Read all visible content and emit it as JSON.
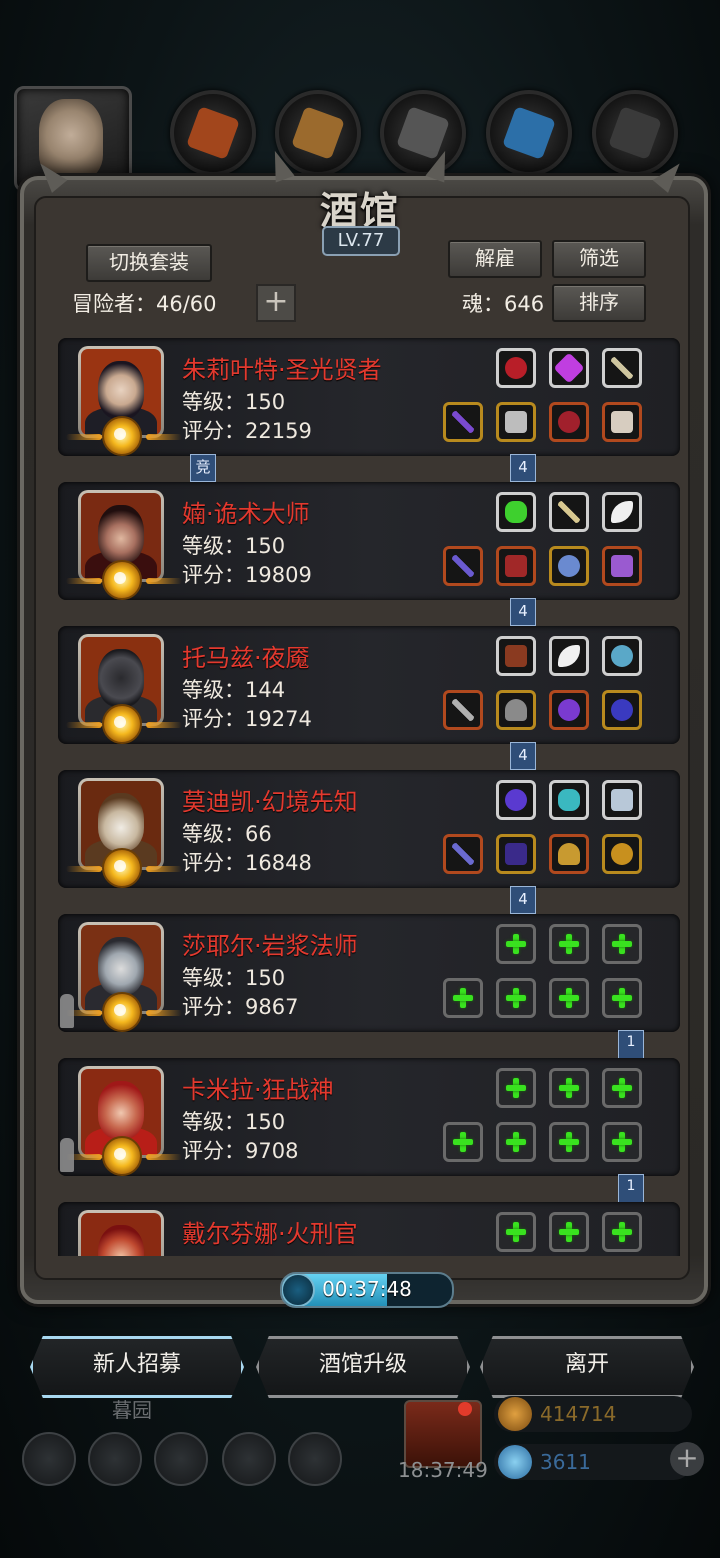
{
  "tavern": {
    "title": "酒馆",
    "level": "LV.77",
    "switch_set_label": "切换套装",
    "dismiss_label": "解雇",
    "filter_label": "筛选",
    "sort_label": "排序",
    "adventurers_label": "冒险者：46/60",
    "soul_label": "魂：646",
    "add_label": "+"
  },
  "heroes": [
    {
      "name": "朱莉叶特·圣光贤者",
      "level": "等级：150",
      "score": "评分：22159",
      "link_left": "竞",
      "link_right": "4"
    },
    {
      "name": "婻·诡术大师",
      "level": "等级：150",
      "score": "评分：19809",
      "link_right": "4"
    },
    {
      "name": "托马兹·夜魇",
      "level": "等级：144",
      "score": "评分：19274",
      "link_right": "4"
    },
    {
      "name": "莫迪凯·幻境先知",
      "level": "等级：66",
      "score": "评分：16848",
      "link_right": "4"
    },
    {
      "name": "莎耶尔·岩浆法师",
      "level": "等级：150",
      "score": "评分：9867",
      "link_right": "1"
    },
    {
      "name": "卡米拉·狂战神",
      "level": "等级：150",
      "score": "评分：9708",
      "link_right": "1"
    },
    {
      "name": "戴尔芬娜·火刑官",
      "level": "",
      "score": ""
    }
  ],
  "timer": {
    "text": "00:37:48",
    "progress": 0.62
  },
  "bottom_buttons": {
    "recruit": "新人招募",
    "upgrade": "酒馆升级",
    "leave": "离开"
  },
  "footer": {
    "label": "暮园",
    "time": "18:37:49",
    "gold": "414714",
    "gems": "3611",
    "plus": "+"
  },
  "colors": {
    "hero_name": "#e3392e",
    "accent_cyan": "#5fb8e8",
    "plus_green": "#39e21f"
  }
}
